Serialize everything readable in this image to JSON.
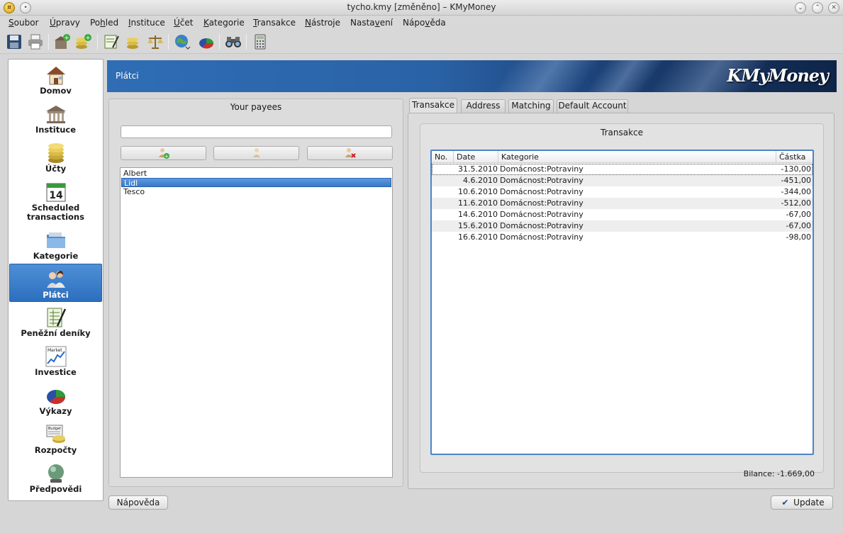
{
  "window": {
    "title": "tycho.kmy [změněno] – KMyMoney"
  },
  "menu": [
    {
      "label": "Soubor",
      "u": "S"
    },
    {
      "label": "Úpravy",
      "u": "Ú"
    },
    {
      "label": "Pohled",
      "u": "h"
    },
    {
      "label": "Instituce",
      "u": "I"
    },
    {
      "label": "Účet",
      "u": "Ú"
    },
    {
      "label": "Kategorie",
      "u": "K"
    },
    {
      "label": "Transakce",
      "u": "T"
    },
    {
      "label": "Nástroje",
      "u": "N"
    },
    {
      "label": "Nastavení",
      "u": "v"
    },
    {
      "label": "Nápověda",
      "u": "v"
    }
  ],
  "sidebar": {
    "items": [
      {
        "label": "Domov",
        "icon": "house-icon"
      },
      {
        "label": "Instituce",
        "icon": "bank-icon"
      },
      {
        "label": "Účty",
        "icon": "coins-icon"
      },
      {
        "label": "Scheduled transactions",
        "icon": "calendar-icon",
        "day": "14"
      },
      {
        "label": "Kategorie",
        "icon": "folder-icon"
      },
      {
        "label": "Plátci",
        "icon": "users-icon"
      },
      {
        "label": "Peněžní deníky",
        "icon": "ledger-icon"
      },
      {
        "label": "Investice",
        "icon": "market-chart-icon",
        "badge": "Market"
      },
      {
        "label": "Výkazy",
        "icon": "pie-chart-icon"
      },
      {
        "label": "Rozpočty",
        "icon": "budget-icon",
        "badge": "Budget"
      },
      {
        "label": "Předpovědi",
        "icon": "crystal-ball-icon"
      }
    ],
    "active_index": 5
  },
  "header": {
    "title": "Plátci",
    "logo": "KMyMoney"
  },
  "payees": {
    "title": "Your payees",
    "search_value": "",
    "list": [
      "Albert",
      "Lidl",
      "Tesco"
    ],
    "selected_index": 1,
    "help_button": "Nápověda"
  },
  "tabs": [
    "Transakce",
    "Address",
    "Matching",
    "Default Account"
  ],
  "active_tab": 0,
  "transactions": {
    "group_title": "Transakce",
    "columns": {
      "no": "No.",
      "date": "Date",
      "category": "Kategorie",
      "amount": "Částka"
    },
    "rows": [
      {
        "no": "",
        "date": "31.5.2010",
        "category": "Domácnost:Potraviny",
        "amount": "-130,00"
      },
      {
        "no": "",
        "date": "4.6.2010",
        "category": "Domácnost:Potraviny",
        "amount": "-451,00"
      },
      {
        "no": "",
        "date": "10.6.2010",
        "category": "Domácnost:Potraviny",
        "amount": "-344,00"
      },
      {
        "no": "",
        "date": "11.6.2010",
        "category": "Domácnost:Potraviny",
        "amount": "-512,00"
      },
      {
        "no": "",
        "date": "14.6.2010",
        "category": "Domácnost:Potraviny",
        "amount": "-67,00"
      },
      {
        "no": "",
        "date": "15.6.2010",
        "category": "Domácnost:Potraviny",
        "amount": "-67,00"
      },
      {
        "no": "",
        "date": "16.6.2010",
        "category": "Domácnost:Potraviny",
        "amount": "-98,00"
      }
    ],
    "balance": "Bilance: -1.669,00"
  },
  "update_button": "Update"
}
